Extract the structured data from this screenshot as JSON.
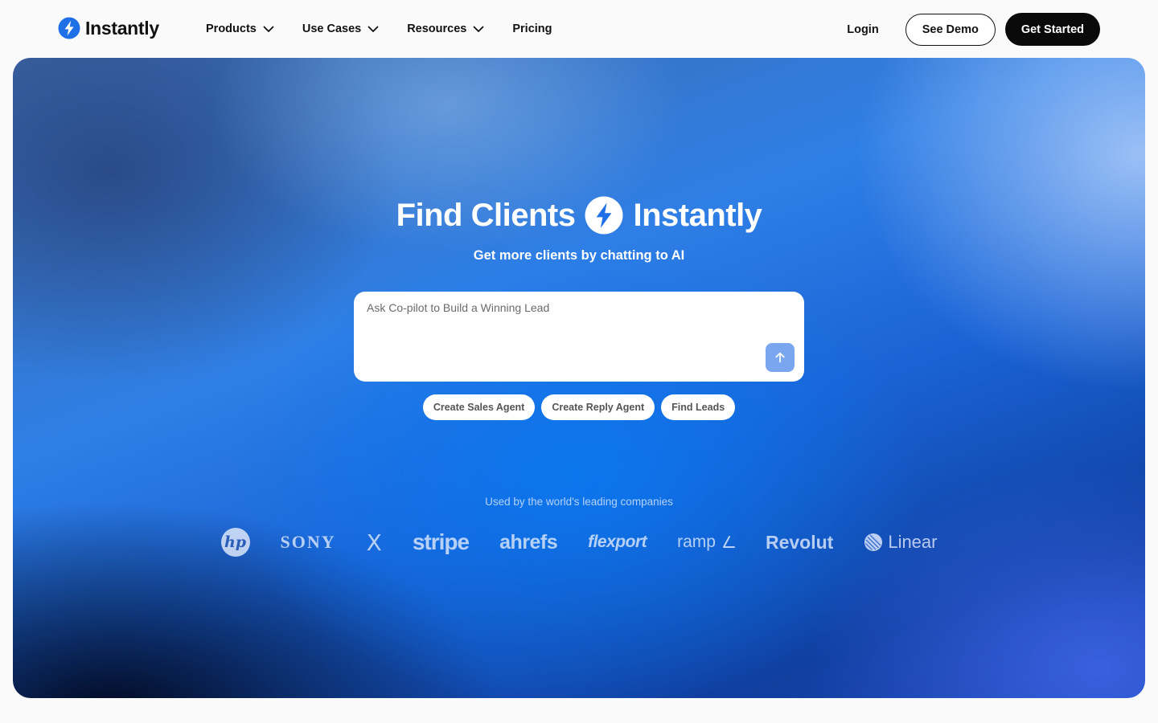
{
  "brand": {
    "name": "Instantly",
    "icon": "lightning-bolt-icon",
    "color": "#1f6fe6"
  },
  "nav": {
    "menu": [
      {
        "label": "Products",
        "has_dropdown": true
      },
      {
        "label": "Use Cases",
        "has_dropdown": true
      },
      {
        "label": "Resources",
        "has_dropdown": true
      },
      {
        "label": "Pricing",
        "has_dropdown": false
      }
    ],
    "login_label": "Login",
    "demo_label": "See Demo",
    "cta_label": "Get Started"
  },
  "hero": {
    "headline_left": "Find Clients",
    "headline_right": "Instantly",
    "subhead": "Get more clients by chatting to AI",
    "prompt": {
      "placeholder": "Ask Co-pilot to Build a Winning Lead",
      "value": "",
      "send_icon": "arrow-up-icon"
    },
    "chips": [
      "Create Sales Agent",
      "Create Reply Agent",
      "Find Leads"
    ],
    "used_by": "Used by the world's leading companies",
    "logos": [
      "hp",
      "SONY",
      "X",
      "stripe",
      "ahrefs",
      "flexport",
      "ramp",
      "Revolut",
      "Linear"
    ]
  },
  "colors": {
    "accent": "#1f6fe6",
    "send_button": "#7aa6ef",
    "dark_button": "#0a0a0a",
    "page_bg": "#fafafa"
  }
}
